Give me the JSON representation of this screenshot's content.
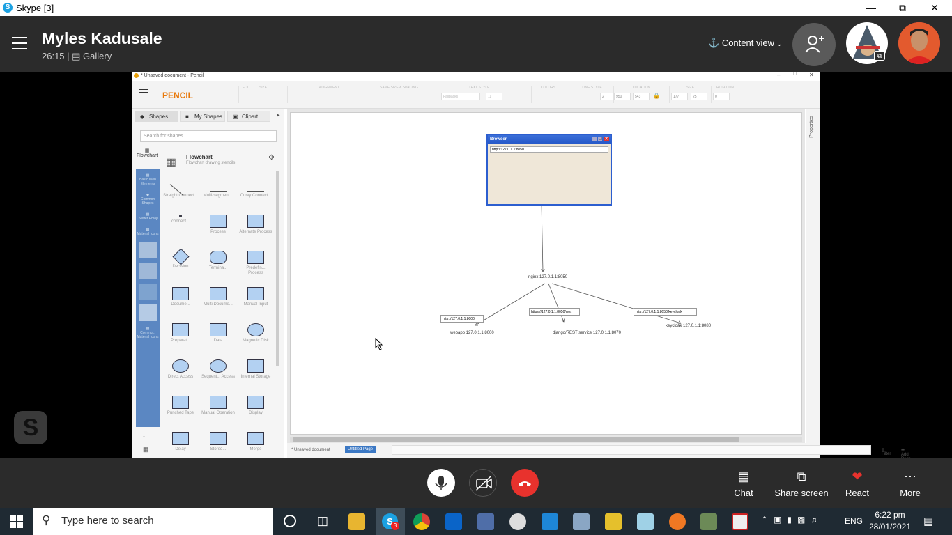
{
  "window": {
    "title": "Skype [3]"
  },
  "call": {
    "name": "Myles Kadusale",
    "duration": "26:15",
    "layout": "Gallery",
    "content_view": "Content view"
  },
  "pencil": {
    "title": "* Unsaved document - Pencil",
    "app": "PENCIL",
    "tabs": [
      "Shapes",
      "My Shapes",
      "Clipart"
    ],
    "search_placeholder": "Search for shapes",
    "collection": {
      "name": "Flowchart",
      "desc": "Flowchart drawing stencils",
      "cat": "Flowchart"
    },
    "categories": [
      "Basic Web Elements",
      "Common Shapes",
      "Twitter Emoji",
      "Material Icons",
      "Commu... Material Icons"
    ],
    "shapes": [
      "Straight Connect...",
      "Multi-segment...",
      "Curvy Connect...",
      "connect...",
      "Process",
      "Alternate Process",
      "Decision",
      "Termina...",
      "Predefin... Process",
      "Docume...",
      "Multi Docume...",
      "Manual Input",
      "Preparat...",
      "Data",
      "Magnetic Disk",
      "Direct Access",
      "Sequent... Access",
      "Internal Storage",
      "Punched Tape",
      "Manual Operation",
      "Display",
      "Delay",
      "Stored...",
      "Merge"
    ],
    "toolbar_groups": [
      "EDIT",
      "SIZE",
      "ALIGNMENT",
      "SAME SIZE & SPACING",
      "TEXT STYLE",
      "COLORS",
      "LINE STYLE",
      "LOCATION",
      "SIZE",
      "ROTATION"
    ],
    "toolbar_values": {
      "font": "Fallbacks",
      "fontsize": "11",
      "linew": "2",
      "x": "950",
      "y": "543",
      "w": "177",
      "h": "25",
      "rot": "0"
    },
    "properties": "Properties",
    "doc": "* Unsaved document",
    "page": "Untitled Page",
    "filter": "Filter",
    "addpage": "Add Page"
  },
  "diagram": {
    "browser_title": "Browser",
    "browser_url": "http://127.0.1.1:8050",
    "nginx": "nginx 127.0.1.1:8050",
    "edge1": "http://127.0.1.1:8000",
    "edge2": "https://127.0.1.1:8050/rest",
    "edge3": "http://127.0.1.1:8050/keycloak",
    "webapp": "webapp 127.0.1.1:8000",
    "django": "django/REST service 127.0.1.1:8070",
    "keycloak": "keycloak 127.0.1.1:8080"
  },
  "controls": {
    "chat": "Chat",
    "share": "Share screen",
    "react": "React",
    "more": "More"
  },
  "taskbar": {
    "search": "Type here to search",
    "lang": "ENG",
    "time": "6:22 pm",
    "date": "28/01/2021",
    "badge": "3"
  }
}
